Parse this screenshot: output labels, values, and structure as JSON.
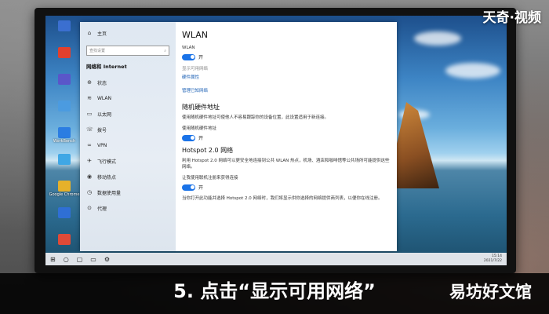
{
  "watermark": {
    "logo_text": "天奇·视频",
    "corner_text": "易坊好文馆"
  },
  "caption": {
    "text": "5. 点击“显示可用网络”"
  },
  "desktop_icons": [
    {
      "label": "",
      "color": "#3b6fd0"
    },
    {
      "label": "",
      "color": "#e2402e"
    },
    {
      "label": "",
      "color": "#5a56c9"
    },
    {
      "label": "",
      "color": "#4b9be0"
    },
    {
      "label": "WorkBench",
      "color": "#2b7de2"
    },
    {
      "label": "",
      "color": "#3fa7e5"
    },
    {
      "label": "Google Chrome",
      "color": "#e6b12a"
    },
    {
      "label": "",
      "color": "#2f6fd5"
    },
    {
      "label": "",
      "color": "#e04a38"
    }
  ],
  "sidebar": {
    "home_label": "主页",
    "search_placeholder": "查找设置",
    "section_title": "网络和 Internet",
    "items": [
      {
        "icon": "⊕",
        "label": "状态"
      },
      {
        "icon": "≋",
        "label": "WLAN"
      },
      {
        "icon": "▭",
        "label": "以太网"
      },
      {
        "icon": "☏",
        "label": "拨号"
      },
      {
        "icon": "∞",
        "label": "VPN"
      },
      {
        "icon": "✈",
        "label": "飞行模式"
      },
      {
        "icon": "◉",
        "label": "移动热点"
      },
      {
        "icon": "◷",
        "label": "数据使用量"
      },
      {
        "icon": "⊙",
        "label": "代理"
      }
    ]
  },
  "content": {
    "title": "WLAN",
    "wlan_label": "WLAN",
    "wlan_state": "开",
    "link_show_networks": "显示可用网络",
    "link_hardware": "硬件属性",
    "link_manage": "管理已知网络",
    "random_title": "随机硬件地址",
    "random_desc": "使用随机硬件地址可使他人不容易跟踪你的设备位置，此设置适用于新连接。",
    "random_toggle_label": "使用随机硬件地址",
    "random_state": "开",
    "hotspot_title": "Hotspot 2.0 网络",
    "hotspot_desc": "利用 Hotspot 2.0 网络可以更安全地连接到公共 WLAN 热点，机场、酒店和咖啡馆等公共场所可能提供这些网络。",
    "hotspot_toggle_label": "让我使用联机注册来获得连接",
    "hotspot_state": "开",
    "hotspot_note": "当你打开此功能并选择 Hotspot 2.0 网络时，我们将显示供你选择的网络提供商列表，以便你在线注册。"
  },
  "taskbar": {
    "time": "15:14",
    "date": "2021/7/22"
  }
}
